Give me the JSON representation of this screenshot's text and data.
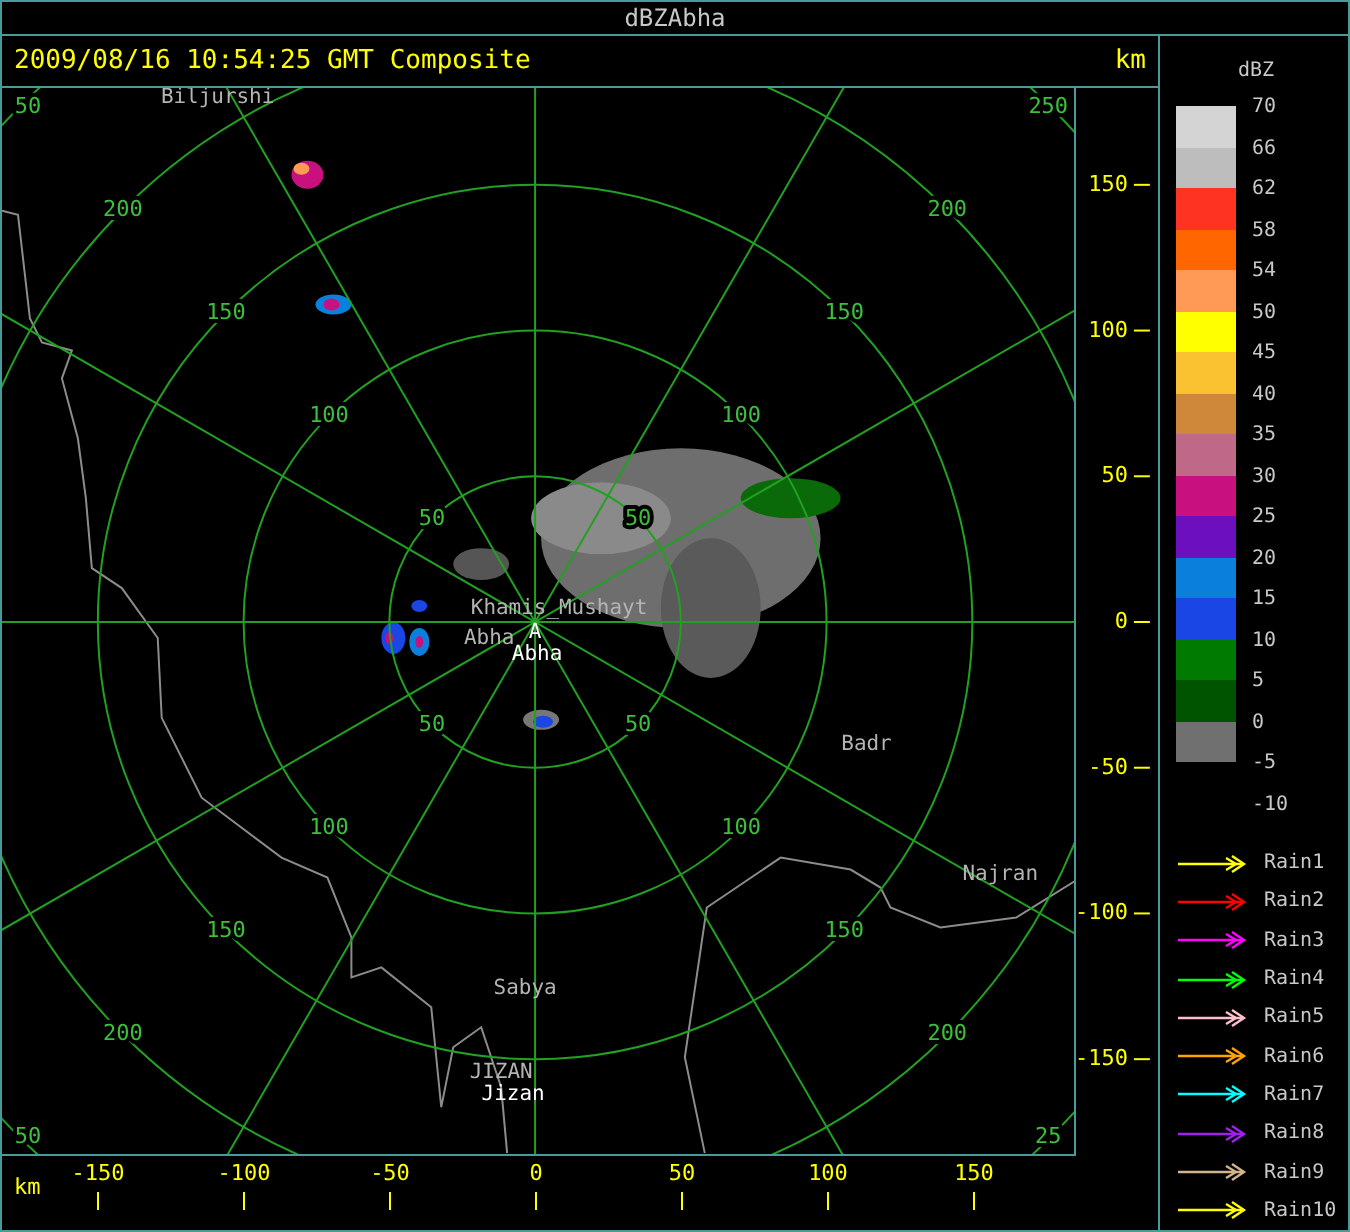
{
  "window": {
    "title": "dBZAbha"
  },
  "header": {
    "timestamp": "2009/08/16 10:54:25 GMT Composite",
    "unit": "km"
  },
  "map": {
    "ring_labels": [
      [
        "50",
        "100",
        "150",
        "200",
        "50"
      ],
      [
        "50",
        "100",
        "150",
        "200",
        "250"
      ],
      [
        "50",
        "100",
        "150",
        "200",
        "50"
      ],
      [
        "50",
        "100",
        "150",
        "200",
        "25"
      ]
    ],
    "places": [
      {
        "name": "Biljurshi",
        "kind": "city"
      },
      {
        "name": "Khamis_Mushayt",
        "kind": "city"
      },
      {
        "name": "Abha",
        "kind": "city"
      },
      {
        "name": "A",
        "kind": "site"
      },
      {
        "name": "Abha",
        "kind": "site"
      },
      {
        "name": "Badr",
        "kind": "city"
      },
      {
        "name": "Najran",
        "kind": "city"
      },
      {
        "name": "Sabya",
        "kind": "city"
      },
      {
        "name": "JIZAN",
        "kind": "city"
      },
      {
        "name": "Jizan",
        "kind": "site"
      }
    ]
  },
  "y_axis": {
    "ticks": [
      "150",
      "100",
      "50",
      "0",
      "-50",
      "-100",
      "-150"
    ]
  },
  "x_axis": {
    "unit": "km",
    "ticks": [
      "-150",
      "-100",
      "-50",
      "0",
      "50",
      "100",
      "150"
    ]
  },
  "scale": {
    "title": "dBZ",
    "bins": [
      {
        "color": "#d4d4d4"
      },
      {
        "color": "#bdbdbd"
      },
      {
        "color": "#ff3322"
      },
      {
        "color": "#ff6600"
      },
      {
        "color": "#ff9955"
      },
      {
        "color": "#ffff00"
      },
      {
        "color": "#fac230"
      },
      {
        "color": "#cf873a"
      },
      {
        "color": "#c06888"
      },
      {
        "color": "#c8117f"
      },
      {
        "color": "#6b0fbf"
      },
      {
        "color": "#0a80dc"
      },
      {
        "color": "#1a46e6"
      },
      {
        "color": "#007a00"
      },
      {
        "color": "#005400"
      },
      {
        "color": "#707070"
      }
    ],
    "labels": [
      "70",
      "66",
      "62",
      "58",
      "54",
      "50",
      "45",
      "40",
      "35",
      "30",
      "25",
      "20",
      "15",
      "10",
      "5",
      "0",
      "-5",
      "-10"
    ]
  },
  "tracks": [
    {
      "label": "Rain1",
      "color": "#ffff00"
    },
    {
      "label": "Rain2",
      "color": "#ff0000"
    },
    {
      "label": "Rain3",
      "color": "#ff00ff"
    },
    {
      "label": "Rain4",
      "color": "#00ff00"
    },
    {
      "label": "Rain5",
      "color": "#ffc0cb"
    },
    {
      "label": "Rain6",
      "color": "#ffa500"
    },
    {
      "label": "Rain7",
      "color": "#00ffff"
    },
    {
      "label": "Rain8",
      "color": "#a020f0"
    },
    {
      "label": "Rain9",
      "color": "#d2b48c"
    },
    {
      "label": "Rain10",
      "color": "#ffff00"
    }
  ]
}
